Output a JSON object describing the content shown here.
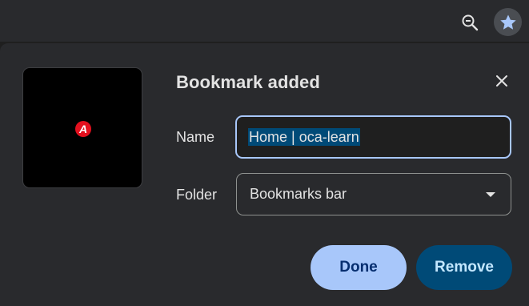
{
  "toolbar": {
    "zoom_icon": "zoom-out-icon",
    "star_icon": "star-filled-icon",
    "colors": {
      "star": "#a8c7fa",
      "background": "#292a2d"
    }
  },
  "dialog": {
    "title": "Bookmark added",
    "close_icon": "close-icon",
    "favicon_letter": "A",
    "favicon_color": "#e3101e",
    "name_label": "Name",
    "name_value": "Home | oca-learn",
    "folder_label": "Folder",
    "folder_value": "Bookmarks bar",
    "done_label": "Done",
    "remove_label": "Remove",
    "colors": {
      "accent": "#a8c7fa",
      "remove_bg": "#004a77",
      "selection": "#004a77"
    }
  }
}
